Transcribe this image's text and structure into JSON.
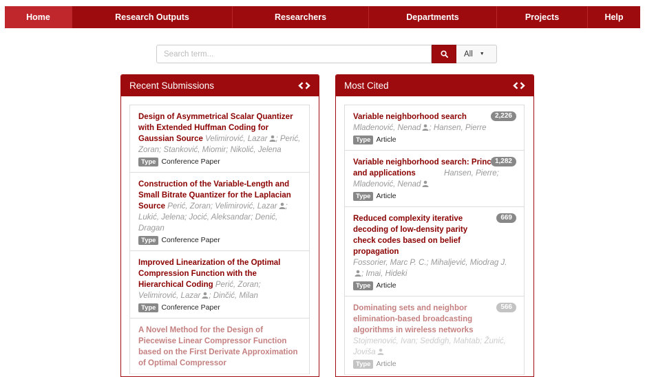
{
  "nav": [
    {
      "label": "Home",
      "active": true
    },
    {
      "label": "Research Outputs"
    },
    {
      "label": "Researchers"
    },
    {
      "label": "Departments"
    },
    {
      "label": "Projects"
    },
    {
      "label": "Help"
    }
  ],
  "search": {
    "placeholder": "Search term...",
    "filter": "All"
  },
  "colors": {
    "brand": "#9e0b0f",
    "title": "#8b0000",
    "badge": "#888888"
  },
  "recent": {
    "heading": "Recent Submissions",
    "type_label": "Type",
    "items": [
      {
        "title": "Design of Asymmetrical Scalar Quantizer with Extended Huffman Coding for Gaussian Source",
        "authors_a": "Velimirović, Lazar",
        "authors_b": "; Perić, Zoran; Stanković, Miomir; Nikolić, Jelena",
        "type": "Conference Paper"
      },
      {
        "title": "Construction of the Variable-Length and Small Bitrate Quantizer for the Laplacian Source",
        "authors_a": "Perić, Zoran; Velimirović, Lazar",
        "authors_b": "; Lukić, Jelena; Jocić, Aleksandar; Denić, Dragan",
        "type": "Conference Paper"
      },
      {
        "title": "Improved Linearization of the Optimal Compression Function with the Hierarchical Coding",
        "authors_a": "Perić, Zoran; Velimirović, Lazar",
        "authors_b": "; Dinčić, Milan",
        "type": "Conference Paper"
      },
      {
        "title": "A Novel Method for the Design of Piecewise Linear Compressor Function based on the First Derivate Approximation of Optimal Compressor",
        "authors_a": "",
        "authors_b": "",
        "type": ""
      }
    ]
  },
  "cited": {
    "heading": "Most Cited",
    "type_label": "Type",
    "items": [
      {
        "title": "Variable neighborhood search",
        "count": "2,226",
        "authors_a": "Mladenović, Nenad",
        "authors_b": "; Hansen, Pierre",
        "type": "Article"
      },
      {
        "title": "Variable neighborhood search: Principles and applications",
        "count": "1,282",
        "authors_a": "Hansen, Pierre; Mladenović, Nenad",
        "authors_b": "",
        "type": "Article"
      },
      {
        "title": "Reduced complexity iterative decoding of low-density parity check codes based on belief propagation",
        "count": "669",
        "authors_a": "Fossorier, Marc P. C.; Mihaljević, Miodrag J.",
        "authors_b": "; Imai, Hideki",
        "type": "Article"
      },
      {
        "title": "Dominating sets and neighbor elimination-based broadcasting algorithms in wireless networks",
        "count": "566",
        "authors_a": "Stojmenović, Ivan; Seddigh, Mahtab; Žunić, Joviša",
        "authors_b": "",
        "type": "Article"
      }
    ]
  }
}
